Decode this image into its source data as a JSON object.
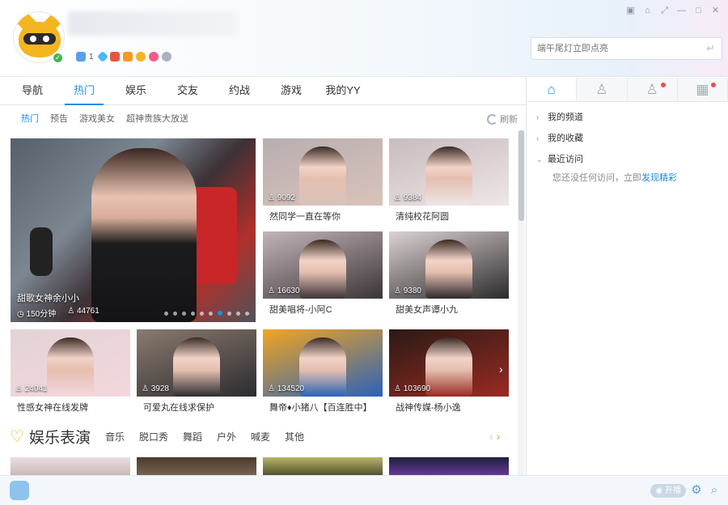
{
  "window": {
    "controls": [
      "skin-icon",
      "shirt-icon",
      "pin-icon",
      "minimize-icon",
      "maximize-icon",
      "close-icon"
    ]
  },
  "header": {
    "badge_count": "1",
    "search": {
      "placeholder": "端午尾灯立即点亮"
    }
  },
  "nav": {
    "tabs": [
      "导航",
      "热门",
      "娱乐",
      "交友",
      "约战",
      "游戏",
      "我的YY"
    ],
    "active": "热门"
  },
  "subnav": {
    "items": [
      "热门",
      "预告",
      "游戏美女",
      "超神贵族大放送"
    ],
    "refresh_label": "刷新"
  },
  "hero": {
    "title": "甜歌女神余小小",
    "duration": "150分钟",
    "views": "44761",
    "dots": 10,
    "active_dot": 6
  },
  "cards": [
    {
      "views": "9092",
      "title": "然同学一直在等你",
      "colors": [
        "#b8aeb0",
        "#d9c3bb"
      ]
    },
    {
      "views": "9384",
      "title": "清纯校花阿圆",
      "colors": [
        "#c7bcbe",
        "#efe6e6"
      ]
    },
    {
      "views": "16630",
      "title": "甜美唱将-小阿C",
      "colors": [
        "#c2b5b9",
        "#3b3437"
      ]
    },
    {
      "views": "9380",
      "title": "甜美女声谭小九",
      "colors": [
        "#dcd2d3",
        "#2c2a2b"
      ]
    },
    {
      "views": "24041",
      "title": "性感女神在线发牌",
      "colors": [
        "#e2d4d6",
        "#f4d6dd"
      ]
    },
    {
      "views": "3928",
      "title": "可爱丸在线求保护",
      "colors": [
        "#8a7a6e",
        "#2d2c30"
      ]
    },
    {
      "views": "134520",
      "title": "舞帝♦小猪八【百连胜中】",
      "colors": [
        "#f2a51f",
        "#2b62b8"
      ]
    },
    {
      "views": "103690",
      "title": "战神传媒-杨小逸",
      "colors": [
        "#2a1a16",
        "#9a2a22"
      ]
    }
  ],
  "section": {
    "title": "娱乐表演",
    "categories": [
      "音乐",
      "脱口秀",
      "舞蹈",
      "户外",
      "喊麦",
      "其他"
    ]
  },
  "right_panel": {
    "tabs": [
      "home-icon",
      "user-icon",
      "friends-icon",
      "apps-icon"
    ],
    "items": [
      "我的频道",
      "我的收藏",
      "最近访问"
    ],
    "note": "您还没任何访问，立即",
    "note_link": "发现精彩"
  },
  "footer": {
    "live_label": "开播"
  },
  "colors": {
    "accent": "#1e8ce6",
    "brand_yellow": "#f3b61f"
  }
}
